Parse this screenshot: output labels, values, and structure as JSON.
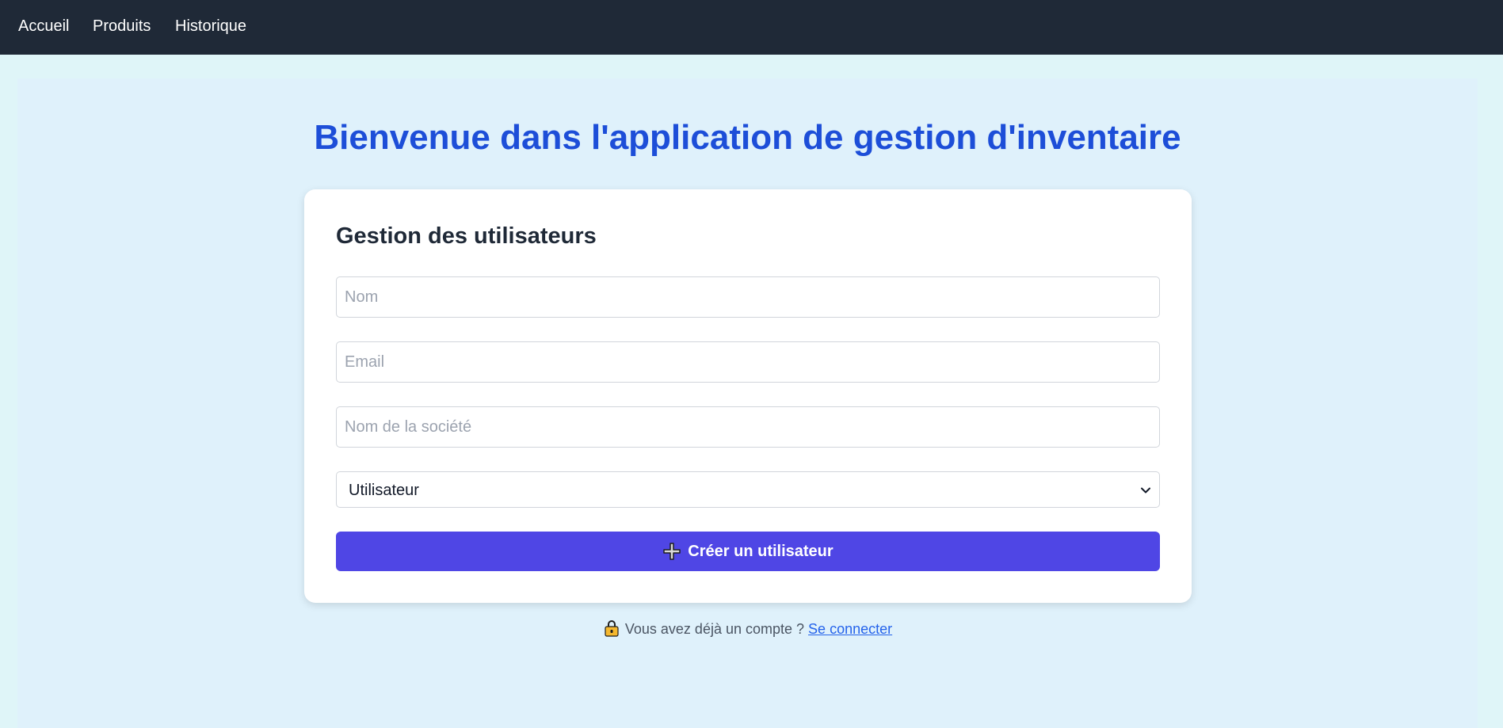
{
  "nav": {
    "items": [
      {
        "label": "Accueil"
      },
      {
        "label": "Produits"
      },
      {
        "label": "Historique"
      }
    ]
  },
  "page": {
    "title": "Bienvenue dans l'application de gestion d'inventaire"
  },
  "card": {
    "title": "Gestion des utilisateurs",
    "fields": {
      "name_placeholder": "Nom",
      "email_placeholder": "Email",
      "company_placeholder": "Nom de la société"
    },
    "role_select": {
      "selected": "Utilisateur"
    },
    "create_button_label": "Créer un utilisateur"
  },
  "login": {
    "prompt": "Vous avez déjà un compte ?",
    "link_label": "Se connecter"
  },
  "icons": {
    "create": "plus-icon",
    "login": "lock-icon",
    "select": "chevron-down-icon"
  },
  "colors": {
    "navbar": "#1f2937",
    "title": "#1d4ed8",
    "accent_button": "#4f46e5",
    "link": "#2563eb",
    "page_background": "#dff5f8",
    "panel_background": "#dff1fb"
  }
}
